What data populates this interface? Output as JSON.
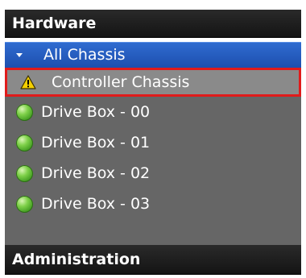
{
  "panel": {
    "hardware_header": "Hardware",
    "administration_header": "Administration",
    "all_chassis_label": "All Chassis"
  },
  "tree": {
    "items": [
      {
        "label": "Controller Chassis",
        "icon": "warning-icon",
        "status": "warning",
        "selected": true
      },
      {
        "label": "Drive Box - 00",
        "icon": "status-ok-icon",
        "status": "ok",
        "selected": false
      },
      {
        "label": "Drive Box - 01",
        "icon": "status-ok-icon",
        "status": "ok",
        "selected": false
      },
      {
        "label": "Drive Box - 02",
        "icon": "status-ok-icon",
        "status": "ok",
        "selected": false
      },
      {
        "label": "Drive Box - 03",
        "icon": "status-ok-icon",
        "status": "ok",
        "selected": false
      }
    ]
  },
  "colors": {
    "header_bg": "#1c1c1c",
    "selected_group_bg": "#2659c4",
    "tree_bg": "#666666",
    "selected_item_bg": "#8a8a8a",
    "selection_border": "#e01b1b",
    "status_ok": "#4caf2a",
    "status_warning": "#f5d000"
  }
}
